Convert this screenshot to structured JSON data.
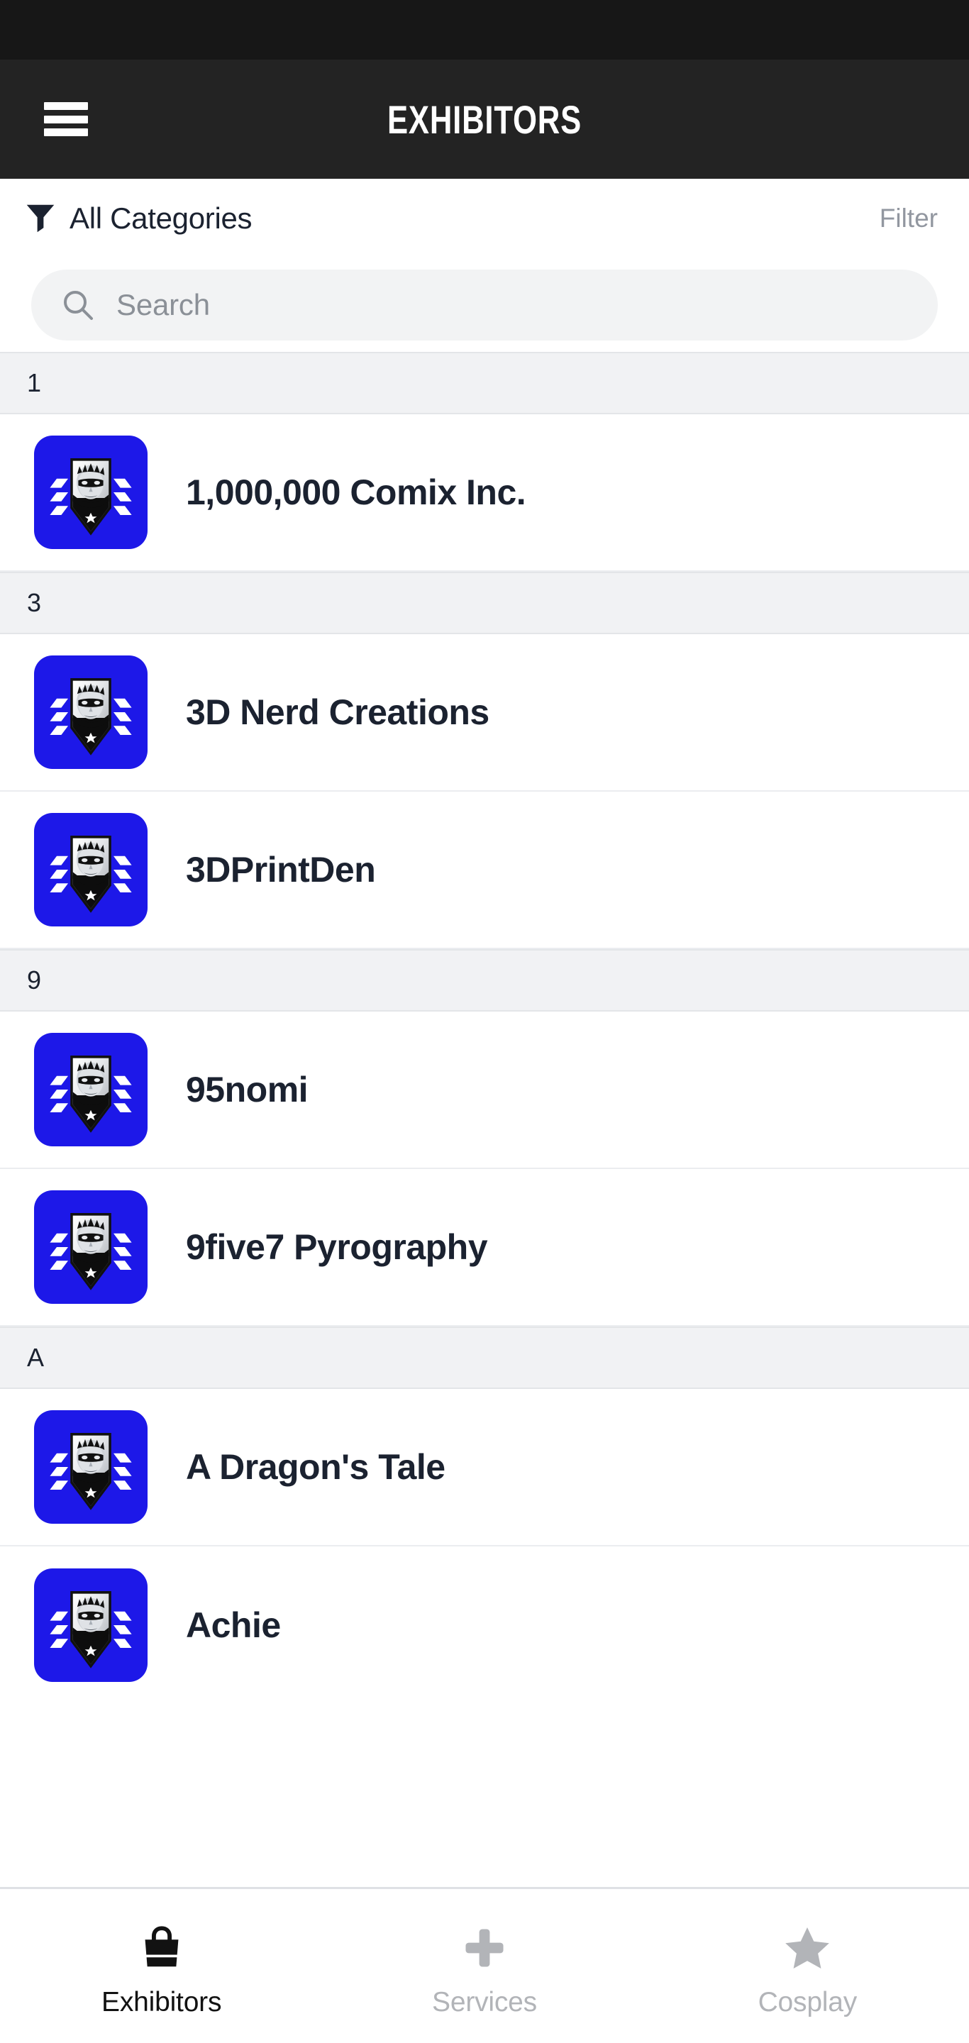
{
  "colors": {
    "statusbar_bg": "#171717",
    "appbar_bg": "#232323",
    "logo_blue": "#1d18e8",
    "section_bg": "#f1f2f4",
    "text_dark": "#1b2230",
    "text_muted": "#9297a0",
    "tab_inactive": "#b2b4b8",
    "search_bg": "#f2f3f4"
  },
  "statusbar": {
    "ghost_text": " "
  },
  "appbar": {
    "menu_icon": "hamburger-menu-icon",
    "title": "EXHIBITORS"
  },
  "filterbar": {
    "funnel_icon": "funnel-icon",
    "category_label": "All Categories",
    "filter_label": "Filter"
  },
  "search": {
    "icon": "search-icon",
    "placeholder": "Search",
    "value": ""
  },
  "list": {
    "sections": [
      {
        "header": "1",
        "items": [
          {
            "name": "1,000,000 Comix Inc.",
            "logo": "exhibitor-shield-logo"
          }
        ]
      },
      {
        "header": "3",
        "items": [
          {
            "name": "3D Nerd Creations",
            "logo": "exhibitor-shield-logo"
          },
          {
            "name": "3DPrintDen",
            "logo": "exhibitor-shield-logo"
          }
        ]
      },
      {
        "header": "9",
        "items": [
          {
            "name": "95nomi",
            "logo": "exhibitor-shield-logo"
          },
          {
            "name": "9five7 Pyrography",
            "logo": "exhibitor-shield-logo"
          }
        ]
      },
      {
        "header": "A",
        "items": [
          {
            "name": "A Dragon's Tale",
            "logo": "exhibitor-shield-logo"
          },
          {
            "name": "Achie",
            "logo": "exhibitor-shield-logo"
          }
        ]
      }
    ]
  },
  "tabbar": {
    "tabs": [
      {
        "label": "Exhibitors",
        "icon": "shopping-bag-icon",
        "active": true
      },
      {
        "label": "Services",
        "icon": "plus-icon",
        "active": false
      },
      {
        "label": "Cosplay",
        "icon": "star-icon",
        "active": false
      }
    ]
  }
}
